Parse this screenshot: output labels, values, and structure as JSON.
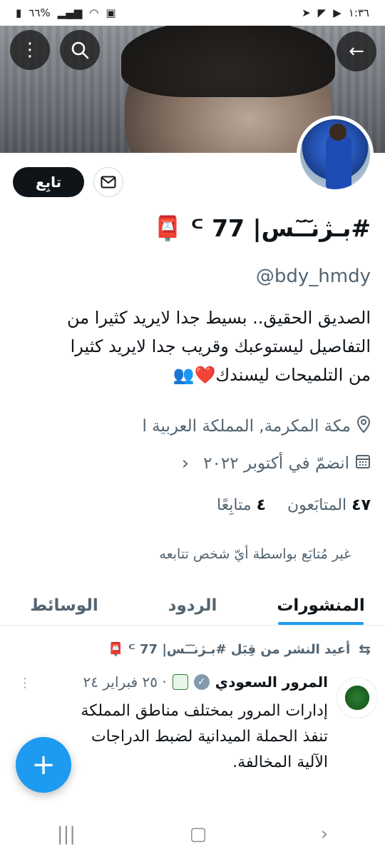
{
  "status_bar": {
    "time": "١:٣٦",
    "battery": "٦٦%"
  },
  "profile": {
    "follow_label": "تابِع",
    "display_name": "#بـژنـٓـٓس| 77 ᒼ 📮",
    "handle": "@bdy_hmdy",
    "bio_lines": [
      "الصديق الحقيق.. بسيط جدا لايريد كثيرا من",
      "التفاصيل ليستوعبك وقريب جدا لايريد كثيرا",
      "من التلميحات  ليسندك❤️👥"
    ],
    "location": "مكة المكرمة, المملكة العربية ا",
    "joined": "انضمّ في أكتوبر ٢٠٢٢",
    "followers_count": "٤٧",
    "followers_label": "المتابَعون",
    "following_count": "٤",
    "following_label": "متابِعًا",
    "not_followed_text": "غير مُتابَع بواسطة أيّ شخص تتابعه"
  },
  "tabs": [
    "المنشورات",
    "الردود",
    "الوسائط"
  ],
  "tweet": {
    "retweet_text": "أعيد النشر من قِبَل #بـژنـٓـٓس| 77 ᒼ 📮",
    "author": "المرور السعودي",
    "date": "· ٢٥ فبراير ٢٤",
    "avatar_caption": "المرور السعودي",
    "text_lines": [
      "إدارات المرور بمختلف مناطق المملكة",
      "تنفذ الحملة الميدانية لضبط الدراجات",
      "الآلية المخالفة."
    ]
  },
  "icons": {
    "back": "back-arrow-icon",
    "search": "search-icon",
    "more": "more-vertical-icon",
    "mail": "mail-icon",
    "location": "location-pin-icon",
    "calendar": "calendar-icon",
    "retweet": "retweet-icon",
    "compose": "plus-icon"
  },
  "colors": {
    "accent": "#1d9bf0",
    "text": "#0f1419",
    "secondary": "#536471"
  }
}
